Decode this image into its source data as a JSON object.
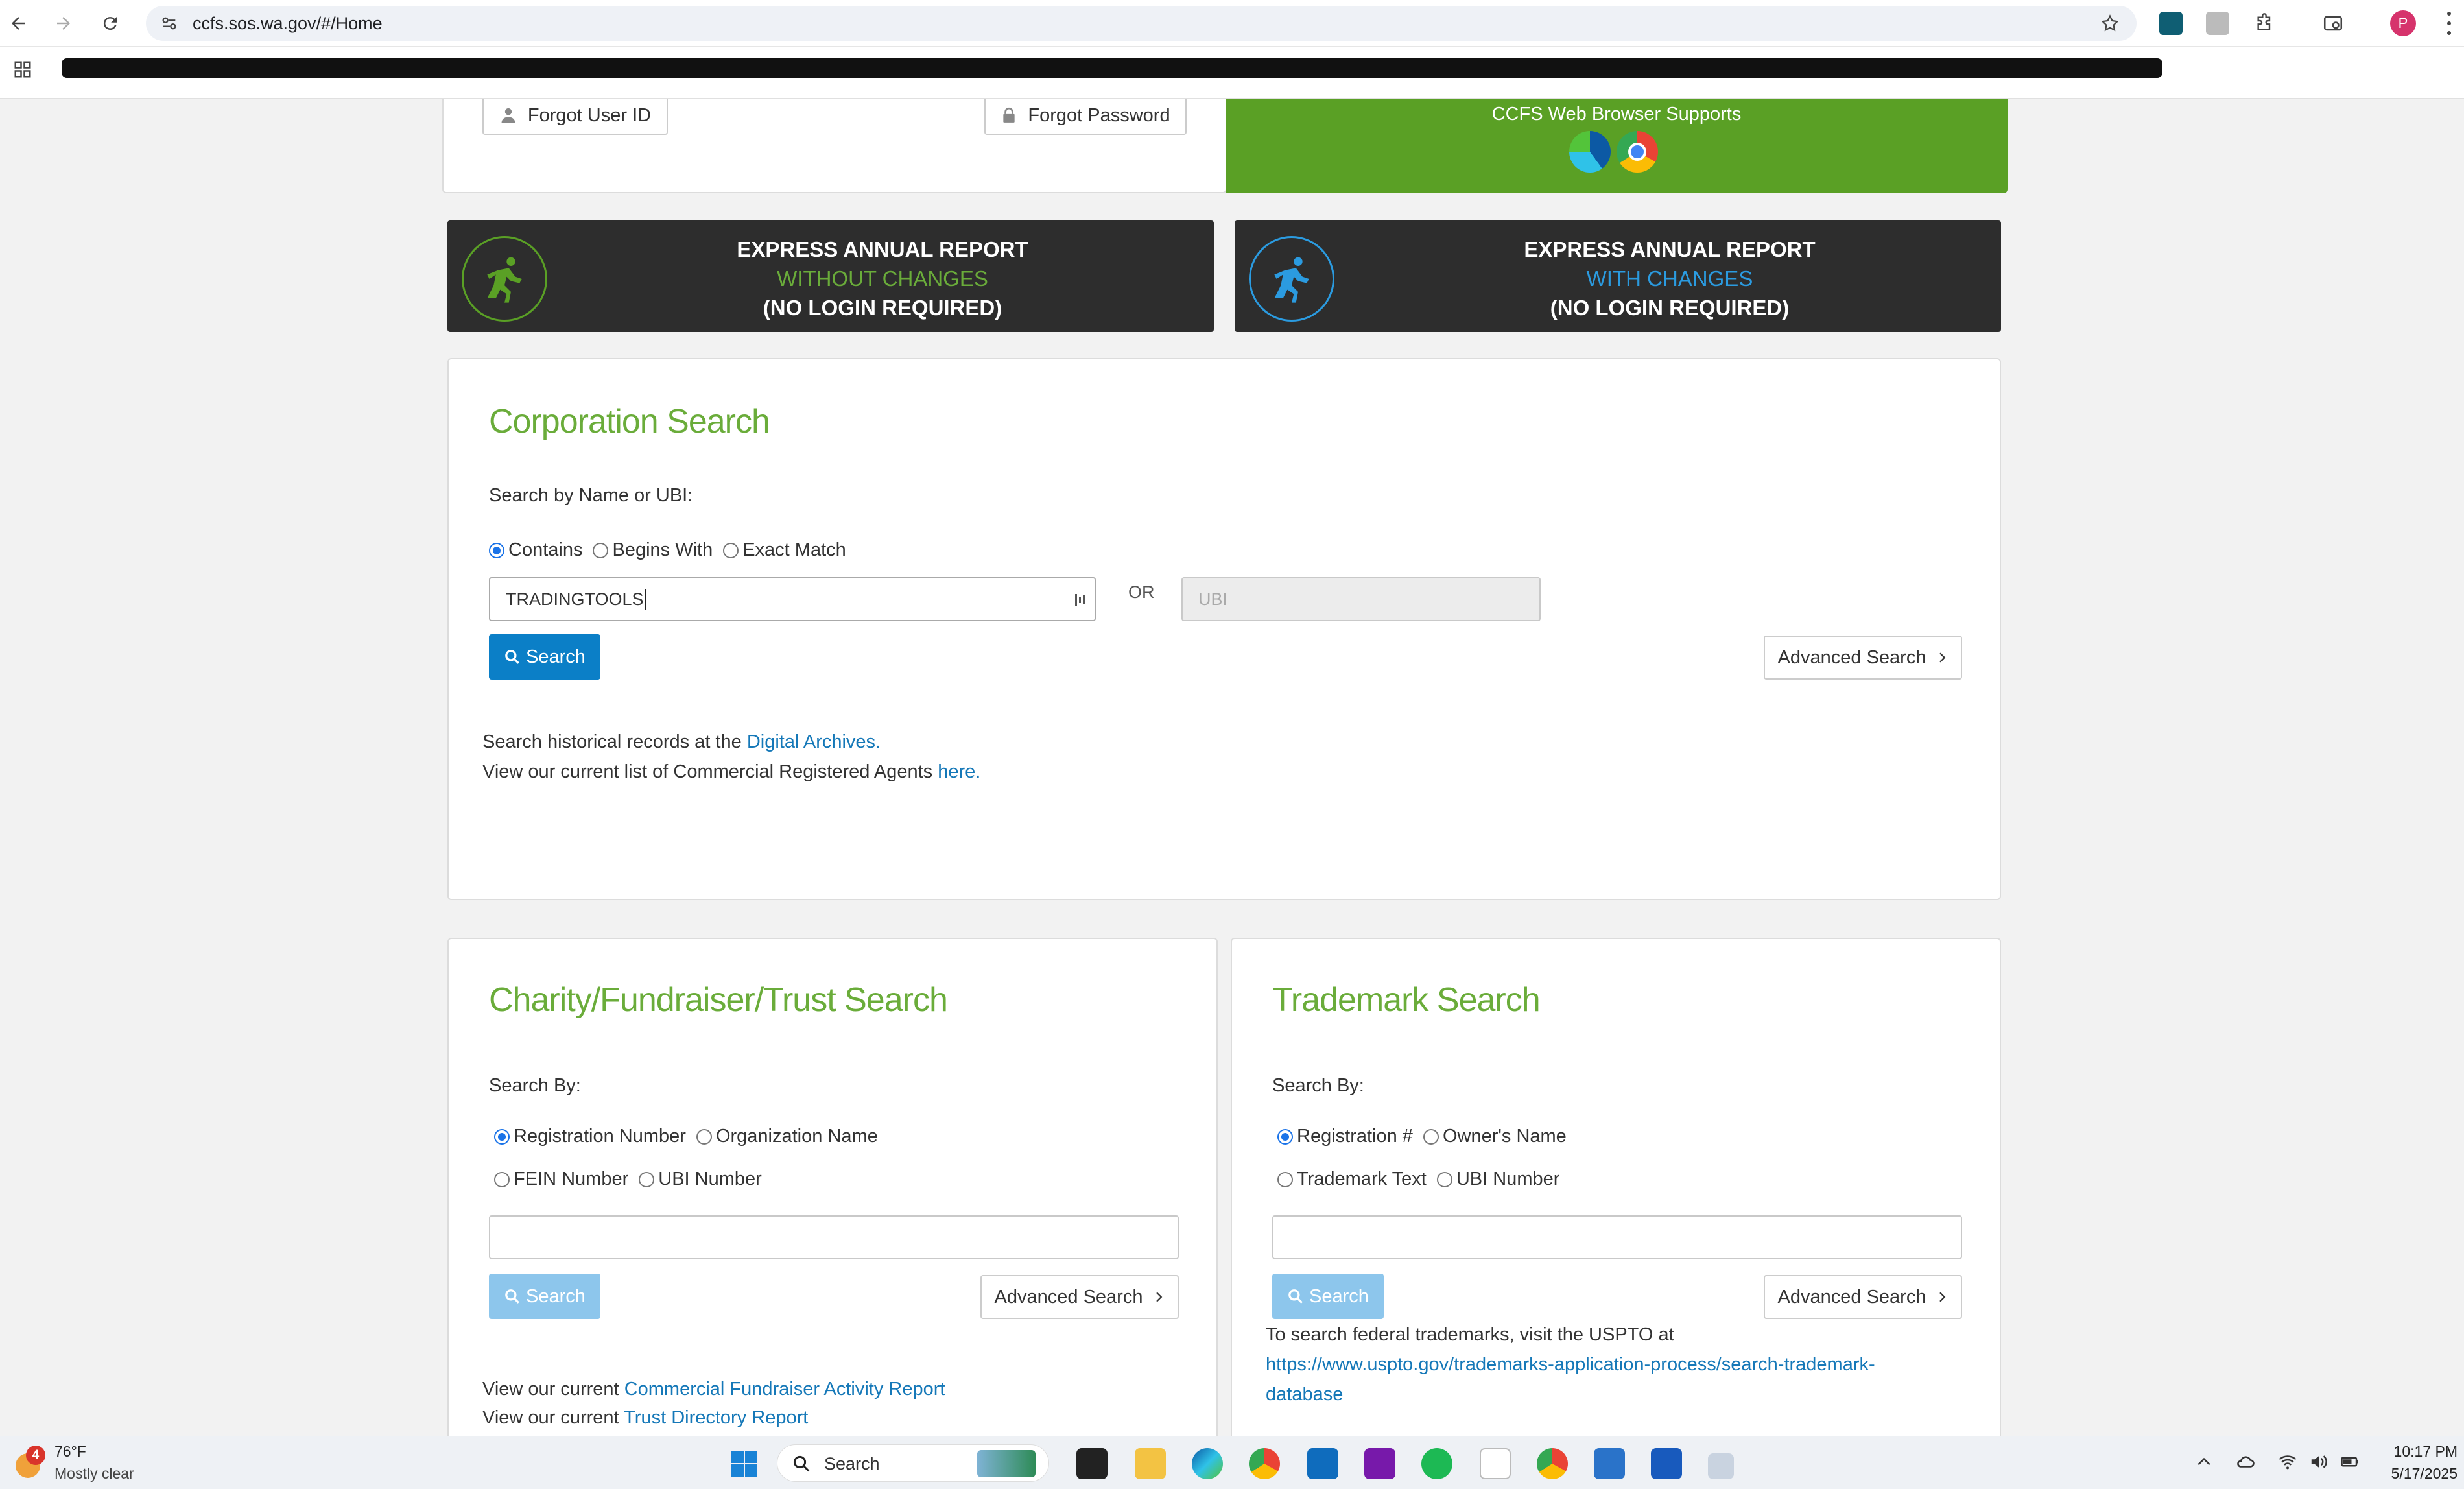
{
  "browser": {
    "url": "ccfs.sos.wa.gov/#/Home",
    "profile_initial": "P"
  },
  "top_card": {
    "forgot_user_id": "Forgot User ID",
    "forgot_password": "Forgot Password",
    "supports_text": "CCFS Web Browser Supports"
  },
  "express_without": {
    "line1": "EXPRESS ANNUAL REPORT",
    "line2": "WITHOUT CHANGES",
    "line3": "(NO LOGIN REQUIRED)",
    "accent": "#6aac3a"
  },
  "express_with": {
    "line1": "EXPRESS ANNUAL REPORT",
    "line2": "WITH CHANGES",
    "line3": "(NO LOGIN REQUIRED)",
    "accent": "#2b9be0"
  },
  "corporation": {
    "title": "Corporation Search",
    "search_by_label": "Search by Name or UBI:",
    "options": [
      "Contains",
      "Begins With",
      "Exact Match"
    ],
    "selected": "Contains",
    "name_value": "TRADINGTOOLS",
    "or_label": "OR",
    "ubi_placeholder": "UBI",
    "search_label": "Search",
    "advanced_label": "Advanced Search",
    "archives_prefix": "Search historical records at the ",
    "archives_link": "Digital Archives.",
    "agents_prefix": "View our current list of Commercial Registered Agents ",
    "agents_link": "here."
  },
  "charity": {
    "title": "Charity/Fundraiser/Trust Search",
    "search_by_label": "Search By:",
    "options_row1": [
      "Registration Number",
      "Organization Name"
    ],
    "options_row2": [
      "FEIN Number",
      "UBI Number"
    ],
    "selected": "Registration Number",
    "search_label": "Search",
    "advanced_label": "Advanced Search",
    "view_prefix": "View our current ",
    "link1": "Commercial Fundraiser Activity Report",
    "link2": "Trust Directory Report"
  },
  "trademark": {
    "title": "Trademark Search",
    "search_by_label": "Search By:",
    "options_row1": [
      "Registration #",
      "Owner's Name"
    ],
    "options_row2": [
      "Trademark Text",
      "UBI Number"
    ],
    "selected": "Registration #",
    "search_label": "Search",
    "advanced_label": "Advanced Search",
    "federal_text": "To search federal trademarks, visit the USPTO at",
    "uspto_link_line1": "https://www.uspto.gov/trademarks-application-process/search-trademark-",
    "uspto_link_line2": "database"
  },
  "taskbar": {
    "weather_temp": "76°F",
    "weather_desc": "Mostly clear",
    "weather_badge": "4",
    "search_label": "Search",
    "time": "10:17 PM",
    "date": "5/17/2025"
  },
  "colors": {
    "green": "#6aac3a",
    "blue_button": "#0b7fc7",
    "link": "#1578b8",
    "banner_bg": "#2d2d2d"
  }
}
